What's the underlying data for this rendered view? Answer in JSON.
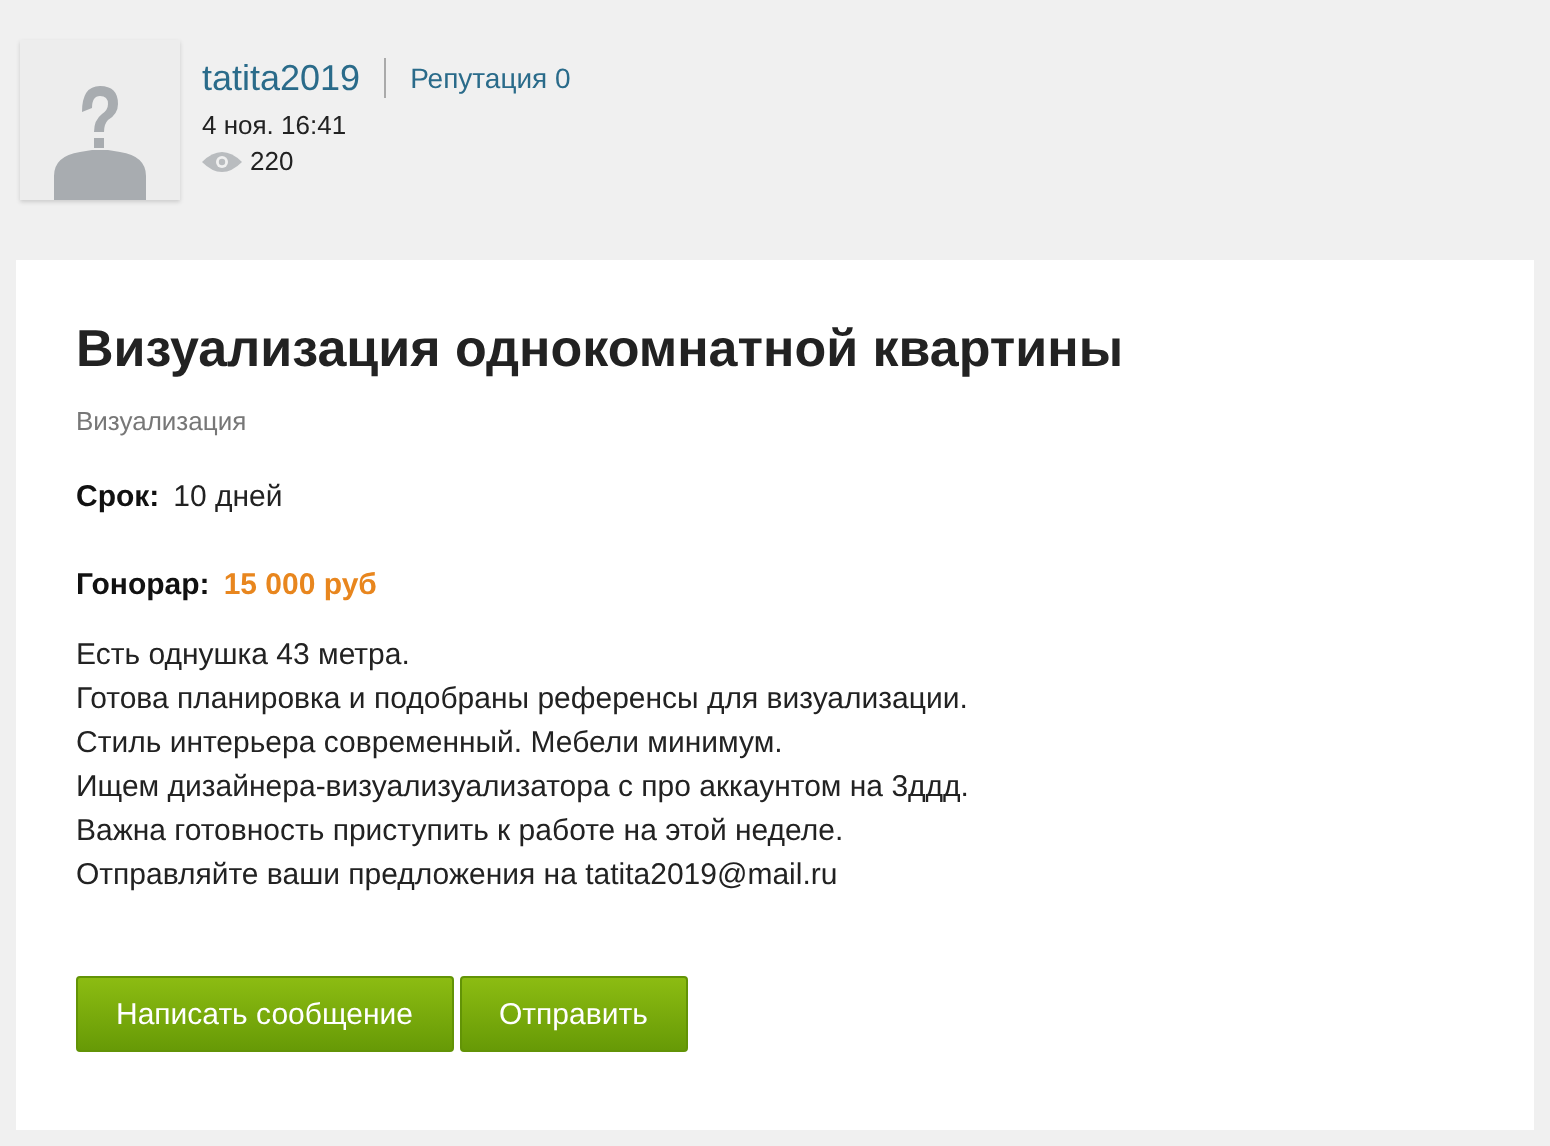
{
  "author": {
    "username": "tatita2019",
    "reputation": "Репутация 0",
    "date": "4 ноя. 16:41",
    "views": "220"
  },
  "post": {
    "title": "Визуализация однокомнатной квартины",
    "category": "Визуализация",
    "fields": [
      {
        "label": "Срок:",
        "value": "10 дней",
        "kind": "plain"
      },
      {
        "label": "Гонорар:",
        "value": "15 000 руб",
        "kind": "price"
      }
    ],
    "description": [
      "Есть однушка 43 метра.",
      "Готова планировка и подобраны референсы для визуализации.",
      "Стиль интерьера современный. Мебели минимум.",
      "Ищем дизайнера-визуализуализатора с про аккаунтом на 3ддд.",
      "Важна готовность приступить к работе на этой неделе.",
      "Отправляйте ваши предложения на tatita2019@mail.ru"
    ],
    "buttons": [
      "Написать сообщение",
      "Отправить"
    ]
  }
}
